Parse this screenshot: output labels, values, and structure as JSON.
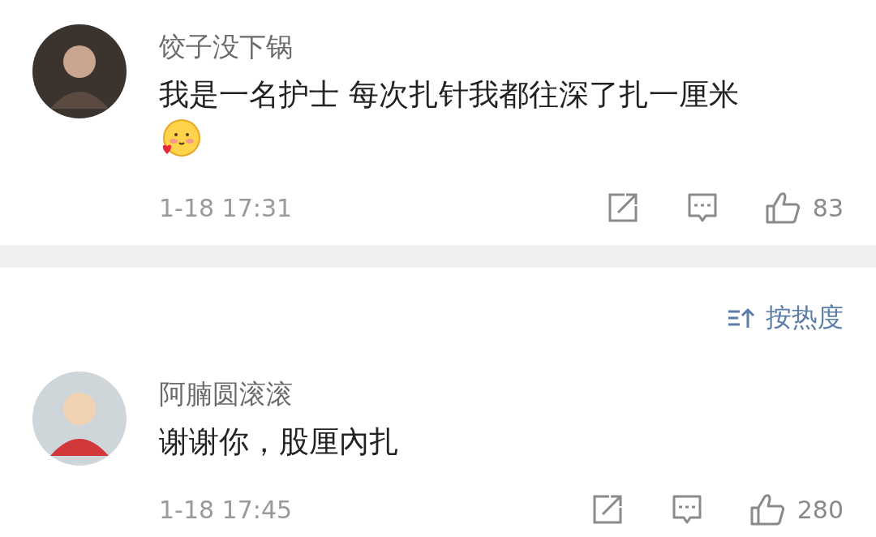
{
  "comments": [
    {
      "name": "饺子没下锅",
      "text": "我是一名护士 每次扎针我都往深了扎一厘米",
      "sticker": true,
      "time": "1-18 17:31",
      "likes": "83"
    },
    {
      "name": "阿腩圆滚滚",
      "text": "谢谢你，股厘內扎",
      "sticker": false,
      "time": "1-18 17:45",
      "likes": "280"
    }
  ],
  "sort": {
    "label": "按热度"
  }
}
